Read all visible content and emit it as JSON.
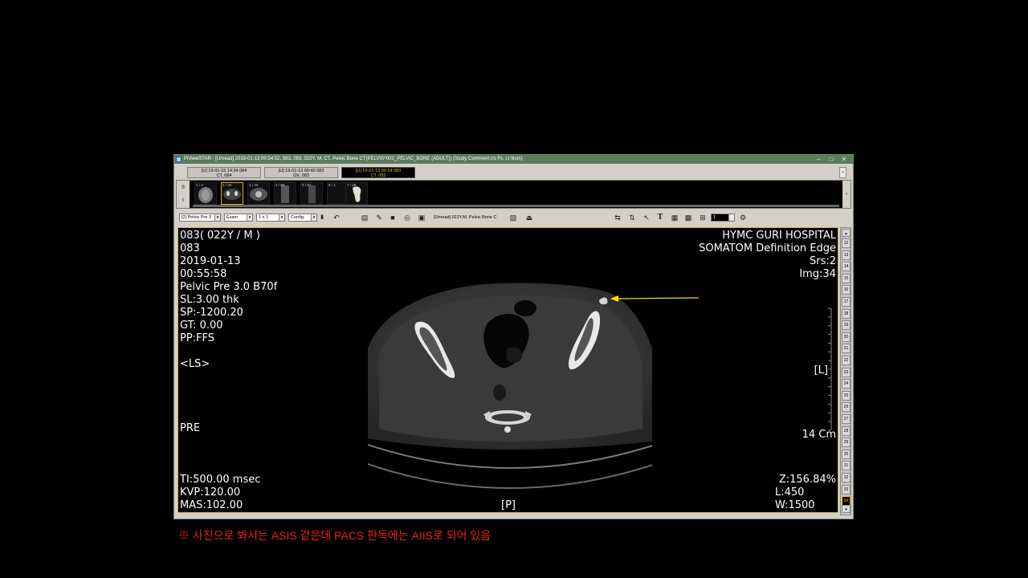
{
  "window": {
    "title": "PiViewSTAR - [Unread] 2019-01-13 00:54:52, 083, 083, 022Y, M, CT, Pelvic Bone CT(PELVIS^002_PELVIC_BONE (ADULT))  (Study Comment:r/o Fx, Lt Ilium)",
    "min": "–",
    "max": "□",
    "close": "✕"
  },
  "study_tabs": [
    {
      "line1": "[U] 19-01-15 14:34  084",
      "line2": "CT, 084"
    },
    {
      "line1": "[U] 19-01-13 00:40  083",
      "line2": "DX, 083"
    },
    {
      "line1": "[U] 19-01-13 00:54  083",
      "line2": "CT, 083"
    }
  ],
  "strip": {
    "side_top": "S",
    "side_bottom": "I",
    "thumbs": [
      "1 / 2",
      "2 / 34",
      "3 / 34",
      "4 / 88",
      "5 / 87",
      "6 / 1",
      "7 / 28"
    ]
  },
  "toolbar": {
    "series_select": "[2] Pelvic Pre  3",
    "exam_select": "Exam",
    "layout_select": "1 x 1",
    "config_select": "Config.",
    "info": "[Unread] 022Y,M, Pelvic Bone C",
    "frame_select": "1"
  },
  "overlay": {
    "patient": "083( 022Y / M )",
    "id": "083",
    "date": "2019-01-13",
    "time": "00:55:58",
    "series": "Pelvic Pre  3.0  B70f",
    "sl": "SL:3.00 thk",
    "sp": "SP:-1200.20",
    "gt": "GT: 0.00",
    "pp": "PP:FFS",
    "ls": " <LS>",
    "pre": "PRE",
    "ti": "TI:500.00 msec",
    "kvp": "KVP:120.00",
    "mas": "MAS:102.00",
    "hospital": "HYMC GURI HOSPITAL",
    "scanner": "SOMATOM Definition Edge",
    "srs": "Srs:2",
    "img": "Img:34",
    "orient_l": "[L]",
    "scale": "14 Cm",
    "zoom": "Z:156.84%",
    "level": "L:450",
    "width": "W:1500",
    "orient_p": "[P]"
  },
  "slices": [
    "12",
    "13",
    "14",
    "15",
    "16",
    "17",
    "18",
    "19",
    "20",
    "21",
    "22",
    "23",
    "24",
    "25",
    "26",
    "27",
    "28",
    "29",
    "30",
    "31",
    "32",
    "33",
    "34"
  ],
  "current_slice": "34",
  "annotation_color": "#f2e600",
  "note": "※ 사진으로 봐서는 ASIS 같은데 PACS 판독에는 AIIS로 되어 있음"
}
